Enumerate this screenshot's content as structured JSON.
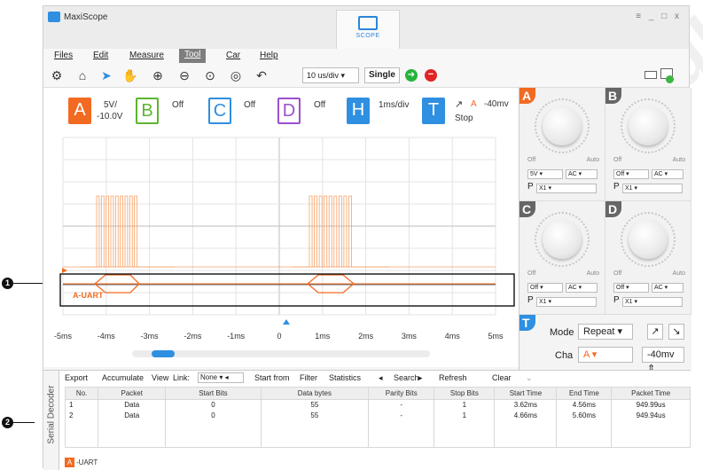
{
  "window": {
    "title": "MaxiScope",
    "controls": "≡ _ □ x"
  },
  "main_tab": {
    "label": "SCOPE"
  },
  "menu": [
    "Files",
    "Edit",
    "Measure",
    "Tool",
    "Car",
    "Help"
  ],
  "toolbar": {
    "timebase": "10 us/div",
    "timebase_arrow": "▾",
    "single_label": "Single"
  },
  "channels": {
    "A": {
      "label": "A",
      "line1": "5V/",
      "line2": "-10.0V",
      "color": "#f26a21"
    },
    "B": {
      "label": "B",
      "status": "Off",
      "color": "#5db531"
    },
    "C": {
      "label": "C",
      "status": "Off",
      "color": "#2f8fe0"
    },
    "D": {
      "label": "D",
      "status": "Off",
      "color": "#9b4fcf"
    },
    "H": {
      "label": "H",
      "value": "1ms/div",
      "color": "#2f8fe0"
    },
    "T": {
      "label": "T",
      "source": "A",
      "level": "-40mv",
      "state": "Stop",
      "color": "#2f8fe0"
    }
  },
  "waveform": {
    "decode_label": "A-UART",
    "x_ticks": [
      "-5ms",
      "-4ms",
      "-3ms",
      "-2ms",
      "-1ms",
      "0",
      "1ms",
      "2ms",
      "3ms",
      "4ms",
      "5ms"
    ]
  },
  "decoder": {
    "side_label": "Serial Decoder",
    "toolbar": {
      "export": "Export",
      "accumulate": "Accumulate",
      "view": "View",
      "link_label": "Link:",
      "link_value": "None",
      "start_from": "Start from",
      "filter": "Filter",
      "statistics": "Statistics",
      "search": "Search",
      "refresh": "Refresh",
      "clear": "Clear"
    },
    "columns": [
      "No.",
      "Packet",
      "Start Bits",
      "Data bytes",
      "Parity Bits",
      "Stop Bits",
      "Start Time",
      "End Time",
      "Packet Time"
    ],
    "rows": [
      [
        "1",
        "Data",
        "0",
        "55",
        "-",
        "1",
        "3.62ms",
        "4.56ms",
        "949.99us"
      ],
      [
        "2",
        "Data",
        "0",
        "55",
        "-",
        "1",
        "4.66ms",
        "5.60ms",
        "949.94us"
      ]
    ],
    "footer": {
      "badge": "A",
      "text": "-UART"
    }
  },
  "panel": {
    "off_label": "Off",
    "auto_label": "Auto",
    "probe_prefix": "P",
    "A": {
      "volt": "5V",
      "coupling": "AC",
      "probe": "X1"
    },
    "B": {
      "volt": "Off",
      "coupling": "AC",
      "probe": "X1"
    },
    "C": {
      "volt": "Off",
      "coupling": "AC",
      "probe": "X1"
    },
    "D": {
      "volt": "Off",
      "coupling": "AC",
      "probe": "X1"
    },
    "trigger": {
      "mode_label": "Mode",
      "mode_value": "Repeat",
      "cha_label": "Cha",
      "cha_value": "A",
      "level": "-40mv"
    }
  },
  "callouts": [
    "1",
    "2"
  ],
  "watermark": "autotoolshop.co.uk"
}
